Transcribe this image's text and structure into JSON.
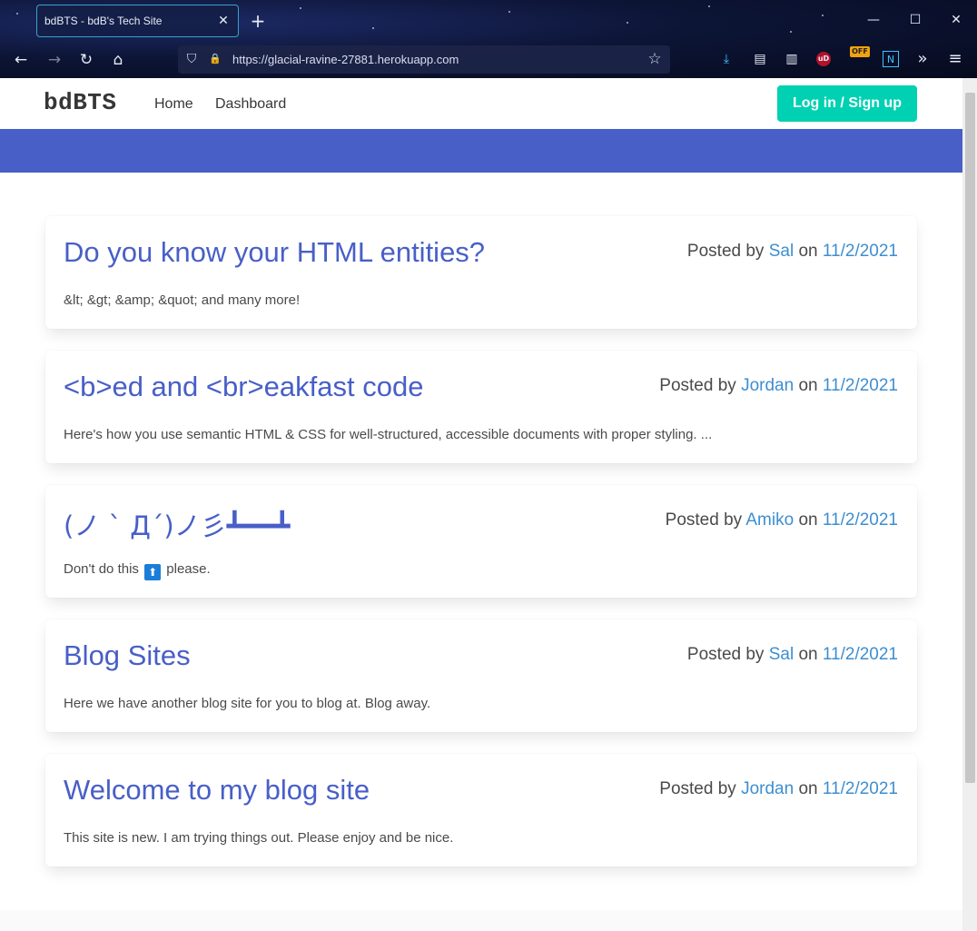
{
  "browser": {
    "tab_title": "bdBTS - bdB's Tech Site",
    "tab_close": "✕",
    "new_tab": "+",
    "url": "https://glacial-ravine-27881.herokuapp.com",
    "minimize": "—",
    "maximize": "☐",
    "close": "✕",
    "back": "←",
    "forward": "→",
    "reload": "↻",
    "home": "⌂",
    "shield": "⛉",
    "lock": "🔒",
    "bookmark_star": "☆",
    "download": "⤓",
    "reader": "▤",
    "library": "▥",
    "ublock_label": "uD",
    "ext_off_label": "OFF",
    "ext_n_label": "N",
    "overflow": "»",
    "menu": "≡"
  },
  "navbar": {
    "brand": "bdBTS",
    "links": [
      "Home",
      "Dashboard"
    ],
    "login_label": "Log in / Sign up"
  },
  "posts": [
    {
      "title": "Do you know your HTML entities?",
      "posted_by": "Posted by",
      "author": "Sal",
      "on": "on",
      "date": "11/2/2021",
      "excerpt": "&lt; &gt; &amp; &quot; and many more!"
    },
    {
      "title": "<b>ed and <br>eakfast code",
      "posted_by": "Posted by",
      "author": "Jordan",
      "on": "on",
      "date": "11/2/2021",
      "excerpt": "Here's how you use semantic HTML & CSS for well-structured, accessible documents with proper styling. ..."
    },
    {
      "title": "(ノ ` Д´)ノ彡┻━━┻",
      "posted_by": "Posted by",
      "author": "Amiko",
      "on": "on",
      "date": "11/2/2021",
      "excerpt_before": "Don't do this",
      "excerpt_emoji": "⬆",
      "excerpt_after": "please."
    },
    {
      "title": "Blog Sites",
      "posted_by": "Posted by",
      "author": "Sal",
      "on": "on",
      "date": "11/2/2021",
      "excerpt": "Here we have another blog site for you to blog at. Blog away."
    },
    {
      "title": "Welcome to my blog site",
      "posted_by": "Posted by",
      "author": "Jordan",
      "on": "on",
      "date": "11/2/2021",
      "excerpt": "This site is new. I am trying things out. Please enjoy and be nice."
    }
  ],
  "colors": {
    "primary": "#485fc7",
    "link": "#3e8ed0",
    "login_button": "#00d1b2",
    "text": "#4a4a4a"
  }
}
